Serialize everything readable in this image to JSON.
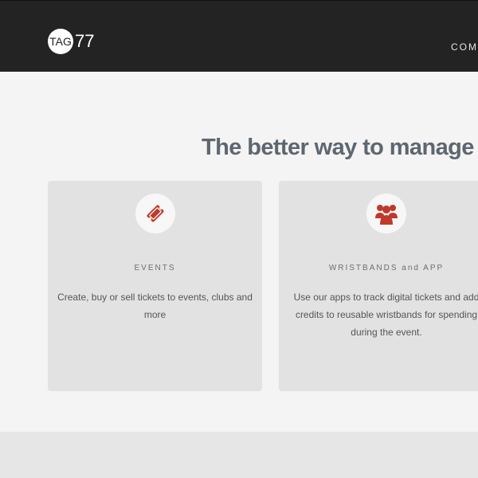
{
  "brand": {
    "badge_text": "TAG",
    "number_text": "77"
  },
  "nav": {
    "visible_text": "COM"
  },
  "hero": {
    "headline": "The better way to manage events"
  },
  "cards": [
    {
      "icon": "ticket-icon",
      "title": "EVENTS",
      "description": "Create, buy or sell tickets to events, clubs and more"
    },
    {
      "icon": "group-people-icon",
      "title": "WRISTBANDS and APP",
      "description": "Use our apps to track digital tickets and add credits to reusable wristbands for spending during the event."
    }
  ],
  "colors": {
    "topbar": "#232323",
    "accent_red": "#c0392b",
    "headline": "#5e6770",
    "card_bg": "#e2e2e2",
    "page_bg": "#f4f4f4"
  }
}
